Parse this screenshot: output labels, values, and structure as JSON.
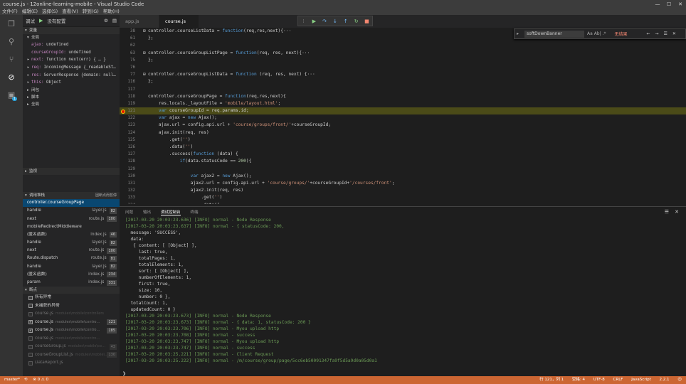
{
  "window": {
    "title": "course.js - 12online-learning-mobile - Visual Studio Code",
    "min": "—",
    "max": "☐",
    "close": "✕"
  },
  "menu": [
    "文件(F)",
    "编辑(E)",
    "选择(S)",
    "查看(V)",
    "转到(G)",
    "帮助(H)"
  ],
  "activity": {
    "badge": "1"
  },
  "sidebar": {
    "header": {
      "title": "调试",
      "config": "没有配置"
    },
    "sections": {
      "variables": "变量",
      "local": "全局",
      "closure": "闭包",
      "script": "脚本",
      "global": "全局",
      "watch": "监视",
      "callstack": "调用堆栈",
      "callstack_status": "因断点而暂停",
      "breakpoints": "断点"
    },
    "variables": [
      {
        "k": "ajax:",
        "v": "undefined",
        "exp": ""
      },
      {
        "k": "courseGroupId:",
        "v": "undefined",
        "exp": ""
      },
      {
        "k": "next:",
        "v": "function next(err) { … }",
        "exp": "▸"
      },
      {
        "k": "req:",
        "v": "IncomingMessage {_readableSt…",
        "exp": "▸"
      },
      {
        "k": "res:",
        "v": "ServerResponse {domain: null…",
        "exp": "▸"
      },
      {
        "k": "this:",
        "v": "Object",
        "exp": "▸"
      }
    ],
    "callstack": [
      {
        "fn": "controller.courseGroupPage",
        "file": "",
        "line": ""
      },
      {
        "fn": "handle",
        "file": "layer.js",
        "line": "82"
      },
      {
        "fn": "next",
        "file": "route.js",
        "line": "100"
      },
      {
        "fn": "mobileRedirectMiddleware",
        "file": "",
        "line": ""
      },
      {
        "fn": "(匿名函数)",
        "file": "index.js",
        "line": "46"
      },
      {
        "fn": "handle",
        "file": "layer.js",
        "line": "82"
      },
      {
        "fn": "next",
        "file": "route.js",
        "line": "100"
      },
      {
        "fn": "Route.dispatch",
        "file": "route.js",
        "line": "81"
      },
      {
        "fn": "handle",
        "file": "layer.js",
        "line": "82"
      },
      {
        "fn": "(匿名函数)",
        "file": "index.js",
        "line": "234"
      },
      {
        "fn": "param",
        "file": "index.js",
        "line": "331"
      }
    ],
    "breakpoints": [
      {
        "name": "所有异常",
        "path": "",
        "line": "",
        "checked": false,
        "dim": false
      },
      {
        "name": "未捕获的异常",
        "path": "",
        "line": "",
        "checked": false,
        "dim": false
      },
      {
        "name": "course.js",
        "path": "modules\\mobile\\controllers",
        "line": "",
        "checked": false,
        "dim": true
      },
      {
        "name": "course.js",
        "path": "modules\\mobile\\contro…",
        "line": "121",
        "checked": true,
        "dim": false
      },
      {
        "name": "course.js",
        "path": "modules\\mobile\\contro…",
        "line": "185",
        "checked": true,
        "dim": false
      },
      {
        "name": "course.js",
        "path": "modules\\mobile\\contro…",
        "line": "",
        "checked": false,
        "dim": true
      },
      {
        "name": "courseGroup.js",
        "path": "modules\\mobile\\co…",
        "line": "43",
        "checked": false,
        "dim": true
      },
      {
        "name": "courseGroupList.js",
        "path": "modules\\mobile\\…",
        "line": "130",
        "checked": false,
        "dim": true
      },
      {
        "name": "DataReport.js",
        "path": "",
        "line": "",
        "checked": false,
        "dim": true
      }
    ]
  },
  "tabs": [
    "app.js",
    "course.js"
  ],
  "find": {
    "value": "softDownBanner",
    "result": "无结果",
    "opts": "Aa  Ab|  .*"
  },
  "editor": {
    "lines": [
      {
        "n": "38",
        "t": "controller.courseListData = function(req,res,next){···",
        "hl": false,
        "bp": false,
        "c": "",
        "fold": "⊞"
      },
      {
        "n": "61",
        "t": "};",
        "hl": false,
        "bp": false,
        "c": "",
        "fold": ""
      },
      {
        "n": "62",
        "t": "",
        "hl": false,
        "bp": false,
        "c": "",
        "fold": ""
      },
      {
        "n": "63",
        "t": "controller.courseGroupListPage = function(req, res, next){···",
        "hl": false,
        "bp": false,
        "c": "",
        "fold": "⊞"
      },
      {
        "n": "75",
        "t": "};",
        "hl": false,
        "bp": false,
        "c": "",
        "fold": ""
      },
      {
        "n": "76",
        "t": "",
        "hl": false,
        "bp": false,
        "c": "",
        "fold": ""
      },
      {
        "n": "77",
        "t": "controller.courseGroupListData = function (req, res, next) {···",
        "hl": false,
        "bp": false,
        "c": "",
        "fold": "⊞"
      },
      {
        "n": "116",
        "t": "};",
        "hl": false,
        "bp": false,
        "c": "",
        "fold": ""
      },
      {
        "n": "117",
        "t": "",
        "hl": false,
        "bp": false,
        "c": "",
        "fold": ""
      },
      {
        "n": "118",
        "t": "controller.courseGroupPage = function(req,res,next){",
        "hl": false,
        "bp": false,
        "c": "",
        "fold": ""
      },
      {
        "n": "119",
        "t": "    res.locals._layoutFile = 'mobile/layout.html';",
        "hl": false,
        "bp": false,
        "c": "",
        "fold": ""
      },
      {
        "n": "121",
        "t": "    var courseGroupId = req.params.id;",
        "hl": true,
        "bp": true,
        "c": "",
        "fold": ""
      },
      {
        "n": "122",
        "t": "    var ajax = new Ajax();",
        "hl": false,
        "bp": false,
        "c": "",
        "fold": ""
      },
      {
        "n": "123",
        "t": "    ajax.url = config.api.url + 'course/groups/front/'+courseGroupId;",
        "hl": false,
        "bp": false,
        "c": "",
        "fold": ""
      },
      {
        "n": "124",
        "t": "    ajax.init(req, res)",
        "hl": false,
        "bp": false,
        "c": "",
        "fold": ""
      },
      {
        "n": "125",
        "t": "        .get('')",
        "hl": false,
        "bp": false,
        "c": "",
        "fold": ""
      },
      {
        "n": "126",
        "t": "        .data('')",
        "hl": false,
        "bp": false,
        "c": "",
        "fold": ""
      },
      {
        "n": "127",
        "t": "        .success(function (data) {",
        "hl": false,
        "bp": false,
        "c": "",
        "fold": ""
      },
      {
        "n": "128",
        "t": "            if(data.statusCode == 200){",
        "hl": false,
        "bp": false,
        "c": "",
        "fold": ""
      },
      {
        "n": "129",
        "t": "",
        "hl": false,
        "bp": false,
        "c": "",
        "fold": ""
      },
      {
        "n": "130",
        "t": "                var ajax2 = new Ajax();",
        "hl": false,
        "bp": false,
        "c": "",
        "fold": ""
      },
      {
        "n": "131",
        "t": "                ajax2.url = config.api.url + 'course/groups/'+courseGroupId+'/courses/front';",
        "hl": false,
        "bp": false,
        "c": "",
        "fold": ""
      },
      {
        "n": "132",
        "t": "                ajax2.init(req, res)",
        "hl": false,
        "bp": false,
        "c": "",
        "fold": ""
      },
      {
        "n": "133",
        "t": "                    .get('')",
        "hl": false,
        "bp": false,
        "c": "",
        "fold": ""
      },
      {
        "n": "134",
        "t": "                    .data({",
        "hl": false,
        "bp": false,
        "c": "",
        "fold": ""
      },
      {
        "n": "135",
        "t": "                        showPreview: false",
        "hl": false,
        "bp": false,
        "c": "",
        "fold": ""
      }
    ]
  },
  "panel": {
    "tabs": [
      "问题",
      "输出",
      "调试控制台",
      "终端"
    ],
    "active": 2,
    "close": "✕",
    "lines": [
      {
        "t": "[2017-03-20 20:03:23.636] [INFO] normal - Node Response",
        "g": true
      },
      {
        "t": "[2017-03-20 20:03:23.637] [INFO] normal - { statusCode: 200,",
        "g": true
      },
      {
        "t": "  message: 'SUCCESS',",
        "g": false
      },
      {
        "t": "  data:",
        "g": false
      },
      {
        "t": "   { content: [ [Object] ],",
        "g": false
      },
      {
        "t": "     last: true,",
        "g": false
      },
      {
        "t": "     totalPages: 1,",
        "g": false
      },
      {
        "t": "     totalElements: 1,",
        "g": false
      },
      {
        "t": "     sort: [ [Object] ],",
        "g": false
      },
      {
        "t": "     numberOfElements: 1,",
        "g": false
      },
      {
        "t": "     first: true,",
        "g": false
      },
      {
        "t": "     size: 10,",
        "g": false
      },
      {
        "t": "     number: 0 },",
        "g": false
      },
      {
        "t": "  totalCount: 1,",
        "g": false
      },
      {
        "t": "  updatedCount: 0 }",
        "g": false
      },
      {
        "t": "[2017-03-20 20:03:23.673] [INFO] normal - Node Response",
        "g": true
      },
      {
        "t": "[2017-03-20 20:03:23.673] [INFO] normal - { data: 1, statusCode: 200 }",
        "g": true
      },
      {
        "t": "[2017-03-20 20:03:23.706] [INFO] normal - Myou upload http",
        "g": true
      },
      {
        "t": "[2017-03-20 20:03:23.708] [INFO] normal - success",
        "g": true
      },
      {
        "t": "[2017-03-20 20:03:23.747] [INFO] normal - Myou upload http",
        "g": true
      },
      {
        "t": "[2017-03-20 20:03:23.747] [INFO] normal - success",
        "g": true
      },
      {
        "t": "[2017-03-20 20:03:25.221] [INFO] normal - Client Request",
        "g": true
      },
      {
        "t": "[2017-03-20 20:03:25.222] [INFO] normal - /m/course/group/page/5cc6eb50091347fa9f5d5a9d0a05d0a1",
        "g": true
      }
    ],
    "prompt": "❯"
  },
  "status": {
    "branch": "master*",
    "sync": "⟲",
    "errors": "⊗ 0  ⚠ 0",
    "pos": "行 121，列 1",
    "spaces": "空格: 4",
    "enc": "UTF-8",
    "eol": "CRLF",
    "lang": "JavaScript",
    "ver": "2.2.1",
    "smile": "☺"
  },
  "colors": {
    "status": "#cc6633",
    "highlight": "#4b4b18"
  }
}
